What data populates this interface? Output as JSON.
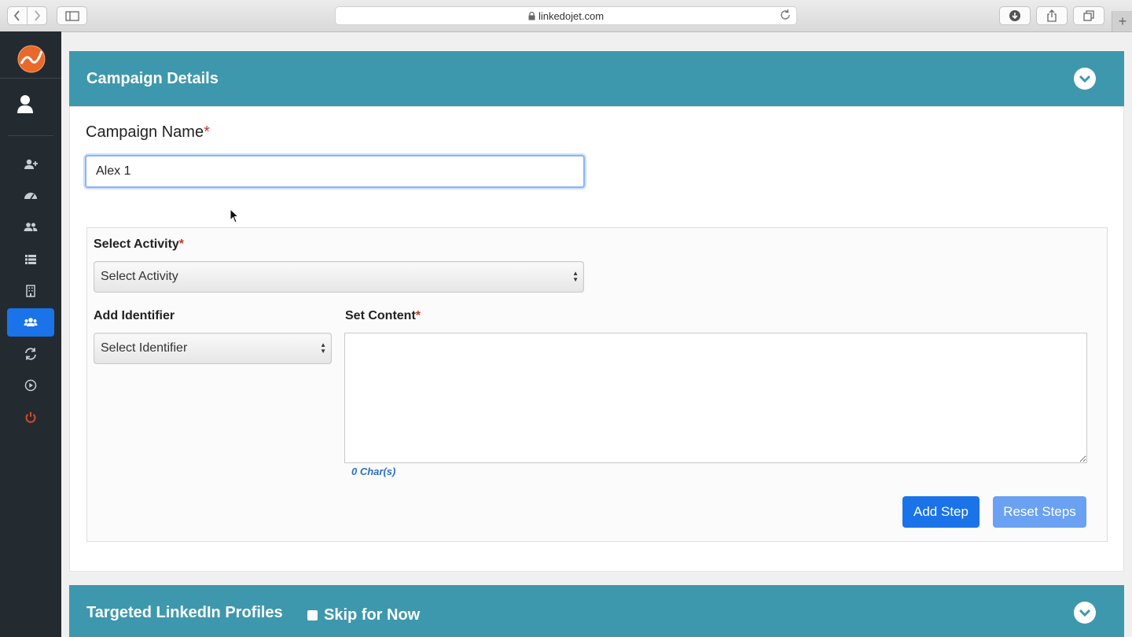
{
  "browser": {
    "url": "linkedojet.com"
  },
  "sidebar": {
    "items": [
      {
        "icon": "user-plus-icon"
      },
      {
        "icon": "dashboard-icon"
      },
      {
        "icon": "users-icon"
      },
      {
        "icon": "list-icon"
      },
      {
        "icon": "building-icon"
      },
      {
        "icon": "campaigns-icon",
        "active": true
      },
      {
        "icon": "refresh-icon"
      },
      {
        "icon": "play-icon"
      },
      {
        "icon": "power-icon"
      }
    ]
  },
  "campaign_details": {
    "title": "Campaign Details",
    "name_label": "Campaign Name",
    "required_mark": "*",
    "name_value": "Alex 1",
    "select_activity_label": "Select Activity",
    "select_activity_value": "Select Activity",
    "add_identifier_label": "Add Identifier",
    "select_identifier_value": "Select Identifier",
    "set_content_label": "Set Content",
    "content_value": "",
    "char_count": "0 Char(s)",
    "add_step_label": "Add Step",
    "reset_steps_label": "Reset Steps"
  },
  "targeted_profiles": {
    "title": "Targeted LinkedIn Profiles",
    "skip_label": "Skip for Now"
  },
  "colors": {
    "header": "#3e98ad",
    "primary": "#1a73e8",
    "primary_light": "#6aa1f2",
    "sidebar": "#232b31",
    "required": "#c0392b"
  }
}
